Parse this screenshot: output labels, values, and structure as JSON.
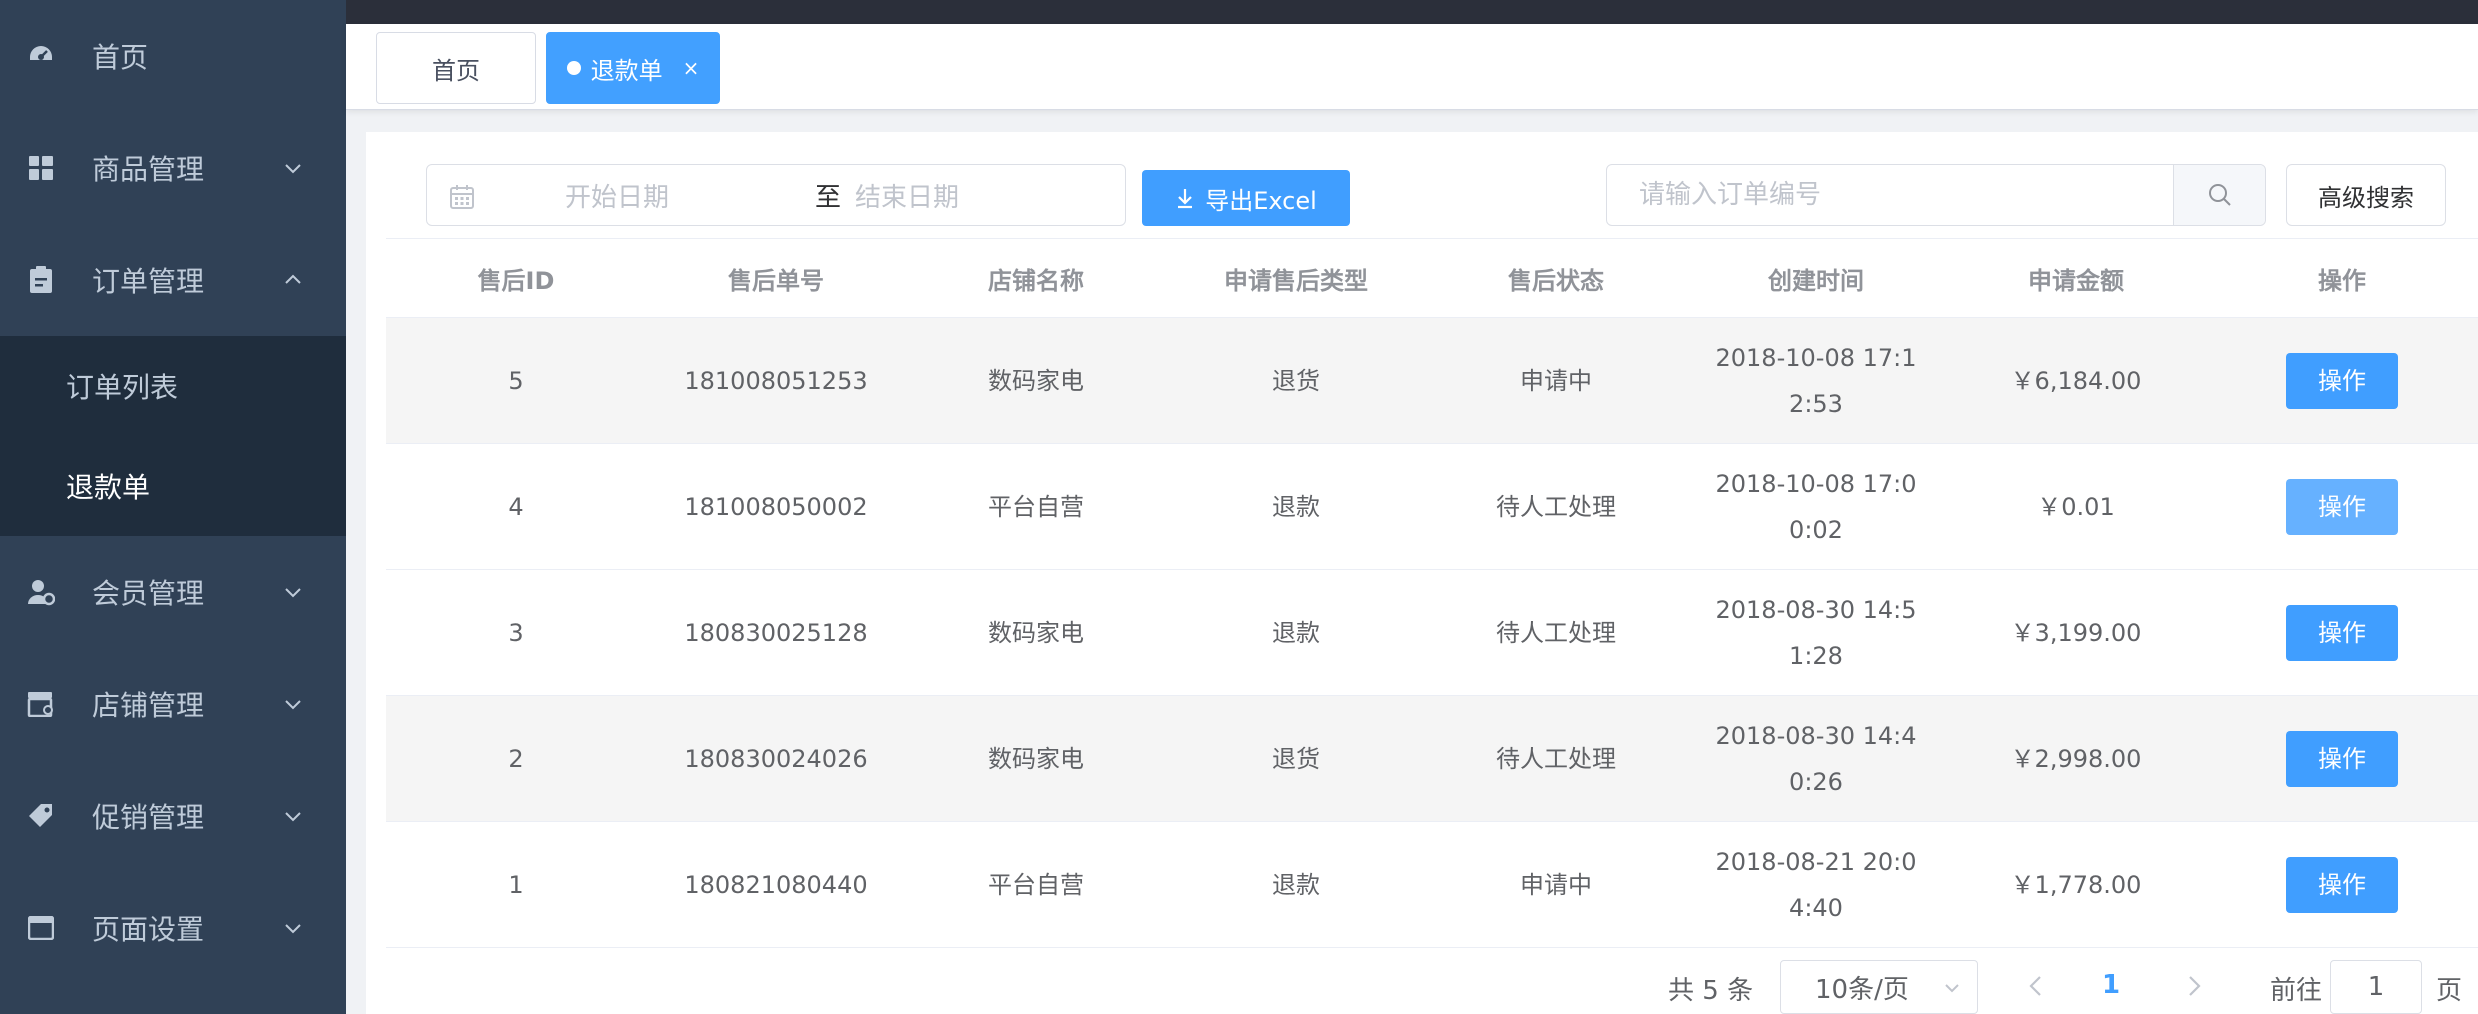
{
  "sidebar": {
    "items": [
      {
        "label": "首页",
        "icon": "dashboard-icon"
      },
      {
        "label": "商品管理",
        "icon": "grid-icon"
      },
      {
        "label": "订单管理",
        "icon": "clipboard-icon"
      },
      {
        "label": "会员管理",
        "icon": "member-icon"
      },
      {
        "label": "店铺管理",
        "icon": "shop-icon"
      },
      {
        "label": "促销管理",
        "icon": "tag-icon"
      },
      {
        "label": "页面设置",
        "icon": "window-icon"
      }
    ],
    "order_sub": [
      "订单列表",
      "退款单"
    ]
  },
  "tags": {
    "home": "首页",
    "refund": "退款单",
    "close": "×"
  },
  "toolbar": {
    "start_placeholder": "开始日期",
    "range_sep": "至",
    "end_placeholder": "结束日期",
    "export_label": "导出Excel",
    "search_placeholder": "请输入订单编号",
    "advanced_label": "高级搜索"
  },
  "table": {
    "headers": [
      "售后ID",
      "售后单号",
      "店铺名称",
      "申请售后类型",
      "售后状态",
      "创建时间",
      "申请金额",
      "操作"
    ],
    "rows": [
      {
        "id": "5",
        "no": "181008051253",
        "shop": "数码家电",
        "type": "退货",
        "status": "申请中",
        "time": "2018-10-08 17:12:53",
        "amount": "￥6,184.00",
        "op": "操作"
      },
      {
        "id": "4",
        "no": "181008050002",
        "shop": "平台自营",
        "type": "退款",
        "status": "待人工处理",
        "time": "2018-10-08 17:00:02",
        "amount": "￥0.01",
        "op": "操作"
      },
      {
        "id": "3",
        "no": "180830025128",
        "shop": "数码家电",
        "type": "退款",
        "status": "待人工处理",
        "time": "2018-08-30 14:51:28",
        "amount": "￥3,199.00",
        "op": "操作"
      },
      {
        "id": "2",
        "no": "180830024026",
        "shop": "数码家电",
        "type": "退货",
        "status": "待人工处理",
        "time": "2018-08-30 14:40:26",
        "amount": "￥2,998.00",
        "op": "操作"
      },
      {
        "id": "1",
        "no": "180821080440",
        "shop": "平台自营",
        "type": "退款",
        "status": "申请中",
        "time": "2018-08-21 20:04:40",
        "amount": "￥1,778.00",
        "op": "操作"
      }
    ]
  },
  "pagination": {
    "total": "共 5 条",
    "page_size": "10条/页",
    "current": "1",
    "goto_label": "前往",
    "goto_value": "1",
    "page_suffix": "页"
  },
  "colors": {
    "sidebar_bg": "#304156",
    "primary": "#409eff"
  }
}
